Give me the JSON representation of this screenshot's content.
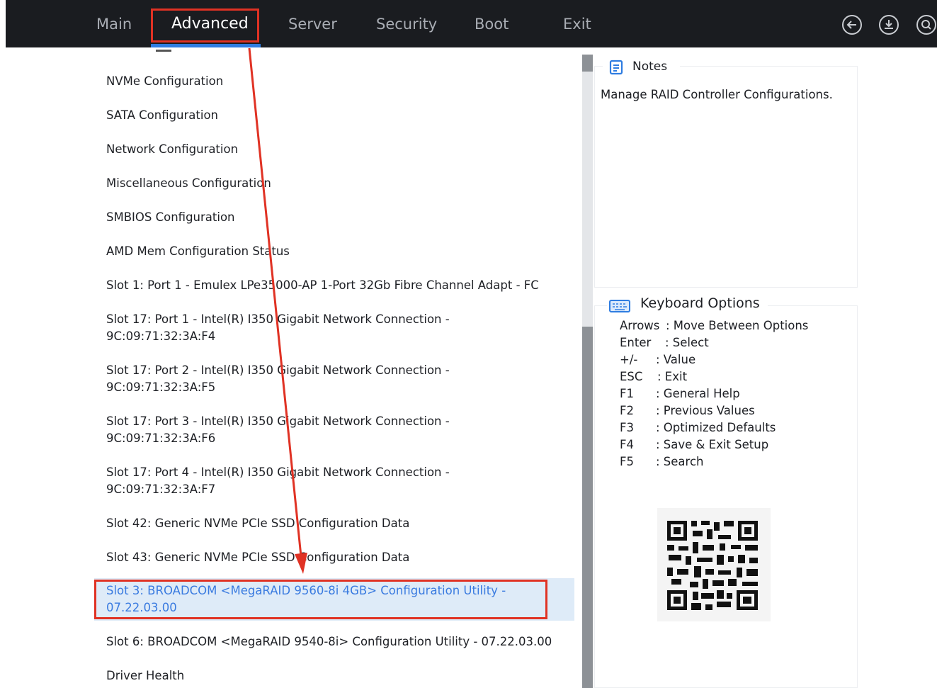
{
  "tabs": [
    {
      "label": "Main"
    },
    {
      "label": "Advanced"
    },
    {
      "label": "Server"
    },
    {
      "label": "Security"
    },
    {
      "label": "Boot"
    },
    {
      "label": "Exit"
    }
  ],
  "header_icons": [
    "back-icon",
    "save-icon",
    "search-icon"
  ],
  "menu": [
    {
      "line1": "NVMe Configuration"
    },
    {
      "line1": "SATA Configuration"
    },
    {
      "line1": "Network Configuration"
    },
    {
      "line1": "Miscellaneous Configuration"
    },
    {
      "line1": "SMBIOS Configuration"
    },
    {
      "line1": "AMD Mem Configuration Status"
    },
    {
      "line1": "Slot 1: Port 1 - Emulex LPe35000-AP 1-Port 32Gb Fibre Channel Adapt - FC"
    },
    {
      "line1": "Slot 17: Port 1 - Intel(R) I350 Gigabit Network Connection -",
      "line2": "9C:09:71:32:3A:F4"
    },
    {
      "line1": "Slot 17: Port 2 - Intel(R) I350 Gigabit Network Connection -",
      "line2": "9C:09:71:32:3A:F5"
    },
    {
      "line1": "Slot 17: Port 3 - Intel(R) I350 Gigabit Network Connection -",
      "line2": "9C:09:71:32:3A:F6"
    },
    {
      "line1": "Slot 17: Port 4 - Intel(R) I350 Gigabit Network Connection -",
      "line2": "9C:09:71:32:3A:F7"
    },
    {
      "line1": "Slot 42: Generic NVMe PCIe SSD Configuration Data"
    },
    {
      "line1": "Slot 43: Generic NVMe PCIe SSD Configuration Data"
    },
    {
      "line1": "Slot 3: BROADCOM <MegaRAID 9560-8i 4GB> Configuration Utility -",
      "line2": "07.22.03.00"
    },
    {
      "line1": "Slot 6: BROADCOM <MegaRAID 9540-8i> Configuration Utility - 07.22.03.00"
    },
    {
      "line1": "Driver Health"
    }
  ],
  "notes": {
    "title": "Notes",
    "text": "Manage RAID Controller Configurations."
  },
  "keyboard": {
    "title": "Keyboard Options",
    "options": [
      {
        "key": "Arrows",
        "desc": ": Move Between Options"
      },
      {
        "key": "Enter",
        "desc": ": Select"
      },
      {
        "key": "+/-",
        "desc": ": Value"
      },
      {
        "key": "ESC",
        "desc": ": Exit"
      },
      {
        "key": "F1",
        "desc": ": General Help"
      },
      {
        "key": "F2",
        "desc": ": Previous Values"
      },
      {
        "key": "F3",
        "desc": ": Optimized Defaults"
      },
      {
        "key": "F4",
        "desc": ": Save & Exit Setup"
      },
      {
        "key": "F5",
        "desc": ": Search"
      }
    ]
  },
  "colors": {
    "selected_text": "#3a7be0",
    "annotation": "#e03224",
    "active_underline": "#2f7de1"
  }
}
